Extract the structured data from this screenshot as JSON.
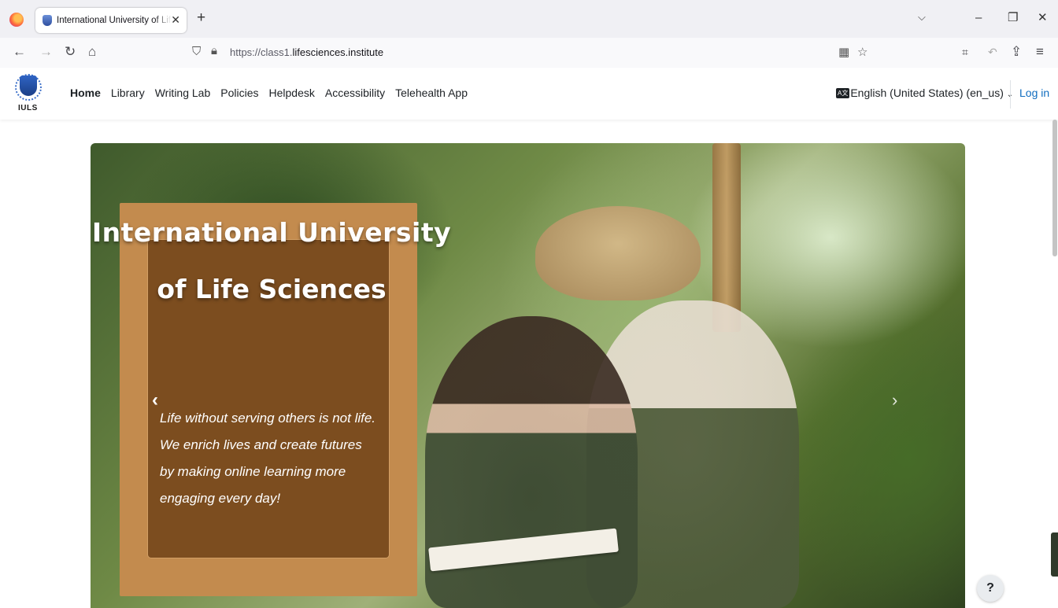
{
  "browser": {
    "tab_title": "International University of Lif",
    "new_tab": "+",
    "close": "✕",
    "url_prefix": "https://class1.",
    "url_domain": "lifesciences.institute",
    "window": {
      "minimize": "–",
      "restore": "❐",
      "close": "✕",
      "tabs_list": "⌵"
    }
  },
  "site": {
    "logo_text": "IULS",
    "nav": [
      "Home",
      "Library",
      "Writing Lab",
      "Policies",
      "Helpdesk",
      "Accessibility",
      "Telehealth App"
    ],
    "language": "English (United States) (en_us)",
    "language_badge": "A文",
    "login": "Log in"
  },
  "hero": {
    "title_line1": "International University",
    "title_line2": "of Life Sciences",
    "tagline_lines": [
      "Life without serving others is not life.",
      "We enrich lives and create futures",
      "by making online learning more",
      "engaging every day!"
    ],
    "prev": "‹",
    "next": "›"
  },
  "help": "?",
  "colors": {
    "panel_outer": "#c38b4e",
    "panel_inner": "#7c4d1f",
    "link": "#0f6cbf"
  }
}
